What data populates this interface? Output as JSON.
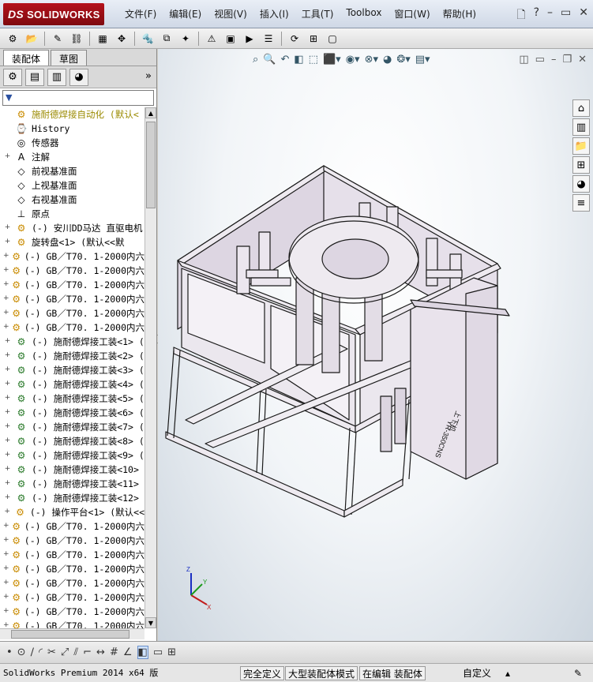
{
  "app": {
    "logo": "SOLIDWORKS",
    "logo_prefix": "DS"
  },
  "menu": [
    "文件(F)",
    "编辑(E)",
    "视图(V)",
    "插入(I)",
    "工具(T)",
    "Toolbox",
    "窗口(W)",
    "帮助(H)"
  ],
  "panel": {
    "tabs": [
      "装配体",
      "草图"
    ],
    "active_tab": "装配体"
  },
  "tree": [
    {
      "label": "施耐德焊接自动化 (默认<",
      "type": "root",
      "expand": ""
    },
    {
      "label": "History",
      "type": "history",
      "expand": ""
    },
    {
      "label": "传感器",
      "type": "sensor",
      "expand": ""
    },
    {
      "label": "注解",
      "type": "annotation",
      "expand": "+"
    },
    {
      "label": "前视基准面",
      "type": "plane",
      "expand": ""
    },
    {
      "label": "上视基准面",
      "type": "plane",
      "expand": ""
    },
    {
      "label": "右视基准面",
      "type": "plane",
      "expand": ""
    },
    {
      "label": "原点",
      "type": "origin",
      "expand": ""
    },
    {
      "label": "(-) 安川DD马达 直驱电机",
      "type": "part",
      "expand": "+"
    },
    {
      "label": "旋转盘<1> (默认<<默",
      "type": "part",
      "expand": "+"
    },
    {
      "label": "(-) GB／T70. 1-2000内六",
      "type": "part",
      "expand": "+"
    },
    {
      "label": "(-) GB／T70. 1-2000内六",
      "type": "part",
      "expand": "+"
    },
    {
      "label": "(-) GB／T70. 1-2000内六",
      "type": "part",
      "expand": "+"
    },
    {
      "label": "(-) GB／T70. 1-2000内六",
      "type": "part",
      "expand": "+"
    },
    {
      "label": "(-) GB／T70. 1-2000内六",
      "type": "part",
      "expand": "+"
    },
    {
      "label": "(-) GB／T70. 1-2000内六",
      "type": "part",
      "expand": "+"
    },
    {
      "label": "(-) 施耐德焊接工装<1> (",
      "type": "sub",
      "expand": "+"
    },
    {
      "label": "(-) 施耐德焊接工装<2> (",
      "type": "sub",
      "expand": "+"
    },
    {
      "label": "(-) 施耐德焊接工装<3> (",
      "type": "sub",
      "expand": "+"
    },
    {
      "label": "(-) 施耐德焊接工装<4> (",
      "type": "sub",
      "expand": "+"
    },
    {
      "label": "(-) 施耐德焊接工装<5> (",
      "type": "sub",
      "expand": "+"
    },
    {
      "label": "(-) 施耐德焊接工装<6> (",
      "type": "sub",
      "expand": "+"
    },
    {
      "label": "(-) 施耐德焊接工装<7> (",
      "type": "sub",
      "expand": "+"
    },
    {
      "label": "(-) 施耐德焊接工装<8> (",
      "type": "sub",
      "expand": "+"
    },
    {
      "label": "(-) 施耐德焊接工装<9> (",
      "type": "sub",
      "expand": "+"
    },
    {
      "label": "(-) 施耐德焊接工装<10>",
      "type": "sub",
      "expand": "+"
    },
    {
      "label": "(-) 施耐德焊接工装<11>",
      "type": "sub",
      "expand": "+"
    },
    {
      "label": "(-) 施耐德焊接工装<12>",
      "type": "sub",
      "expand": "+"
    },
    {
      "label": "(-) 操作平台<1> (默认<<",
      "type": "part",
      "expand": "+"
    },
    {
      "label": "(-) GB／T70. 1-2000内六",
      "type": "part",
      "expand": "+"
    },
    {
      "label": "(-) GB／T70. 1-2000内六",
      "type": "part",
      "expand": "+"
    },
    {
      "label": "(-) GB／T70. 1-2000内六",
      "type": "part",
      "expand": "+"
    },
    {
      "label": "(-) GB／T70. 1-2000内六",
      "type": "part",
      "expand": "+"
    },
    {
      "label": "(-) GB／T70. 1-2000内六",
      "type": "part",
      "expand": "+"
    },
    {
      "label": "(-) GB／T70. 1-2000内六",
      "type": "part",
      "expand": "+"
    },
    {
      "label": "(-) GB／T70. 1-2000内六",
      "type": "part",
      "expand": "+"
    },
    {
      "label": "(-) GB／T70. 1-2000内六",
      "type": "part",
      "expand": "+"
    }
  ],
  "model": {
    "panel_label_1": "YR-350CNS",
    "panel_label_2": "上下机"
  },
  "status": {
    "app": "SolidWorks Premium 2014 x64 版",
    "defined": "完全定义",
    "mode": "大型装配体模式",
    "editing": "在编辑 装配体",
    "custom": "自定义"
  },
  "colors": {
    "frame_fill": "#eeeaf0",
    "panel_fill": "#e6e0ea",
    "edge": "#1a1a1a",
    "brand": "#b5121b"
  }
}
